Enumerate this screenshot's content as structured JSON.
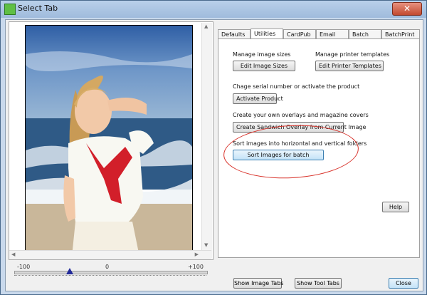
{
  "window": {
    "title": "Select Tab",
    "close_glyph": "✕"
  },
  "slider": {
    "min_label": "-100",
    "mid_label": "0",
    "max_label": "+100",
    "value": -33
  },
  "tabs": [
    {
      "label": "Defaults"
    },
    {
      "label": "Utilities"
    },
    {
      "label": "CardPub"
    },
    {
      "label": "Email"
    },
    {
      "label": "Batch"
    },
    {
      "label": "BatchPrint"
    }
  ],
  "utilities": {
    "image_sizes_label": "Manage image sizes",
    "edit_image_sizes": "Edit Image Sizes",
    "printer_templates_label": "Manage printer templates",
    "edit_printer_templates": "Edit Printer Templates",
    "serial_label": "Chage serial number or activate the product",
    "activate_product": "Activate Product",
    "overlays_label": "Create your own overlays and magazine covers",
    "create_sandwich": "Create Sandwich Overlay from Current Image",
    "sort_label": "Sort images into horizontal and vertical folders",
    "sort_images": "Sort Images for batch",
    "help": "Help"
  },
  "bottom": {
    "show_image_tabs": "Show Image Tabs",
    "show_tool_tabs": "Show Tool Tabs",
    "close": "Close"
  },
  "colors": {
    "annotation": "#d8322a",
    "accent": "#3c7fb1"
  }
}
